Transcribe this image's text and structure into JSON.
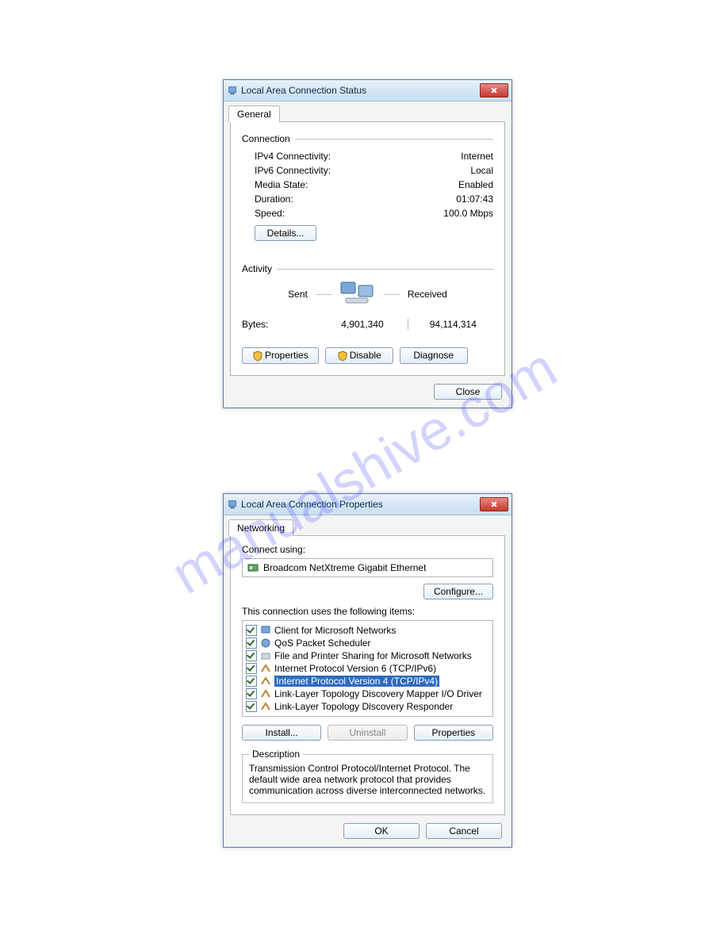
{
  "watermark": "manualshive.com",
  "dialog1": {
    "title": "Local Area Connection Status",
    "tab": "General",
    "connection_label": "Connection",
    "rows": [
      {
        "k": "IPv4 Connectivity:",
        "v": "Internet"
      },
      {
        "k": "IPv6 Connectivity:",
        "v": "Local"
      },
      {
        "k": "Media State:",
        "v": "Enabled"
      },
      {
        "k": "Duration:",
        "v": "01:07:43"
      },
      {
        "k": "Speed:",
        "v": "100.0 Mbps"
      }
    ],
    "details_btn": "Details...",
    "activity_label": "Activity",
    "sent_label": "Sent",
    "received_label": "Received",
    "bytes_label": "Bytes:",
    "bytes_sent": "4,901,340",
    "bytes_recv": "94,114,314",
    "properties_btn": "Properties",
    "disable_btn": "Disable",
    "diagnose_btn": "Diagnose",
    "close_btn": "Close"
  },
  "dialog2": {
    "title": "Local Area Connection Properties",
    "tab": "Networking",
    "connect_using_label": "Connect using:",
    "adapter": "Broadcom NetXtreme Gigabit Ethernet",
    "configure_btn": "Configure...",
    "items_label": "This connection uses the following items:",
    "items": [
      {
        "text": "Client for Microsoft Networks",
        "selected": false
      },
      {
        "text": "QoS Packet Scheduler",
        "selected": false
      },
      {
        "text": "File and Printer Sharing for Microsoft Networks",
        "selected": false
      },
      {
        "text": "Internet Protocol Version 6 (TCP/IPv6)",
        "selected": false
      },
      {
        "text": "Internet Protocol Version 4 (TCP/IPv4)",
        "selected": true
      },
      {
        "text": "Link-Layer Topology Discovery Mapper I/O Driver",
        "selected": false
      },
      {
        "text": "Link-Layer Topology Discovery Responder",
        "selected": false
      }
    ],
    "install_btn": "Install...",
    "uninstall_btn": "Uninstall",
    "itemprops_btn": "Properties",
    "description_label": "Description",
    "description_text": "Transmission Control Protocol/Internet Protocol. The default wide area network protocol that provides communication across diverse interconnected networks.",
    "ok_btn": "OK",
    "cancel_btn": "Cancel"
  }
}
